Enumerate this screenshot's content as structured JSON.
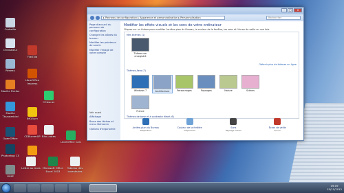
{
  "desktop": {
    "icons": [
      {
        "label": "Corbeille",
        "color": "#c9d6e3"
      },
      {
        "label": "Ordinateur",
        "color": "#d7e3ef"
      },
      {
        "label": "FileZilla",
        "color": "#c0392b"
      },
      {
        "label": "Réseau",
        "color": "#9ab7d3"
      },
      {
        "label": "Mozilla Firefox",
        "color": "#e67e22"
      },
      {
        "label": "LibreOffice Impress",
        "color": "#d35400"
      },
      {
        "label": "CCleaner",
        "color": "#2ecc71"
      },
      {
        "label": "Mozilla Thunderbird",
        "color": "#3498db"
      },
      {
        "label": "IMGBurn",
        "color": "#f1c40f"
      },
      {
        "label": "OpenOffice",
        "color": "#1a5276"
      },
      {
        "label": "CDBurnerXP",
        "color": "#e74c3c"
      },
      {
        "label": "Bloc-notes",
        "color": "#ecf0f1"
      },
      {
        "label": "LibreOffice Calc",
        "color": "#27ae60"
      },
      {
        "label": "Photoshop CS",
        "color": "#154360"
      },
      {
        "label": "VLC",
        "color": "#f39c12"
      },
      {
        "label": "Lettre au mois",
        "color": "#ecf0f1"
      },
      {
        "label": "Microsoft Office Excel 2003",
        "color": "#1e8449"
      },
      {
        "label": "Tableau des inventaires",
        "color": "#ecf0f1"
      },
      {
        "label": "GIMP",
        "color": "#7f8c8d"
      }
    ]
  },
  "window": {
    "address": "▸ Panneau de configuration ▸ Apparence et personnalisation ▸ Personnalisation",
    "search_placeholder": "Rechercher",
    "buttons": {
      "minimize": "–",
      "maximize": "□",
      "close": "x"
    },
    "left_links": [
      "Page d'accueil du panneau de configuration",
      "Changer les icônes du bureau",
      "Modifier les pointeurs de souris",
      "Modifier l'image de votre compte"
    ],
    "see_also": [
      "Voir aussi",
      "Affichage",
      "Barre des tâches et menu Démarrer",
      "Options d'ergonomie"
    ],
    "heading": "Modifier les effets visuels et les sons de votre ordinateur",
    "subheading": "Cliquez sur un thème pour modifier l'arrière-plan du Bureau, la couleur de la fenêtre, les sons et l'écran de veille en une fois.",
    "sections": {
      "mine": "Mes thèmes (1)",
      "aero": "Thèmes Aero (7)",
      "basic": "Thèmes de base et à contraste élevé (6)"
    },
    "more_themes": "Obtenir plus de thèmes en ligne",
    "themes_mine": [
      {
        "label": "Thème non enregistré",
        "color": "#4a5a6e"
      }
    ],
    "themes_aero": [
      {
        "label": "Windows 7",
        "color": "#2f6fb5"
      },
      {
        "label": "Architecture",
        "color": "#8aa3c7"
      },
      {
        "label": "Personnages",
        "color": "#a8c56a"
      },
      {
        "label": "Paysages",
        "color": "#6a8fbf"
      },
      {
        "label": "Nature",
        "color": "#b9c98f"
      },
      {
        "label": "Scènes",
        "color": "#e7b0d0"
      },
      {
        "label": "France",
        "color": "#9fb4d1"
      }
    ],
    "bottom": [
      {
        "title": "Arrière-plan du Bureau",
        "sub": "Diaporama",
        "color": "#2f6fb5"
      },
      {
        "title": "Couleur de la fenêtre",
        "sub": "Crépuscule",
        "color": "#6fa3d8"
      },
      {
        "title": "Sons",
        "sub": "Paysage urbain",
        "color": "#444"
      },
      {
        "title": "Écran de veille",
        "sub": "Aucun",
        "color": "#c0392b"
      }
    ]
  },
  "taskbar": {
    "time": "09:09",
    "date": "15/11/2012"
  }
}
